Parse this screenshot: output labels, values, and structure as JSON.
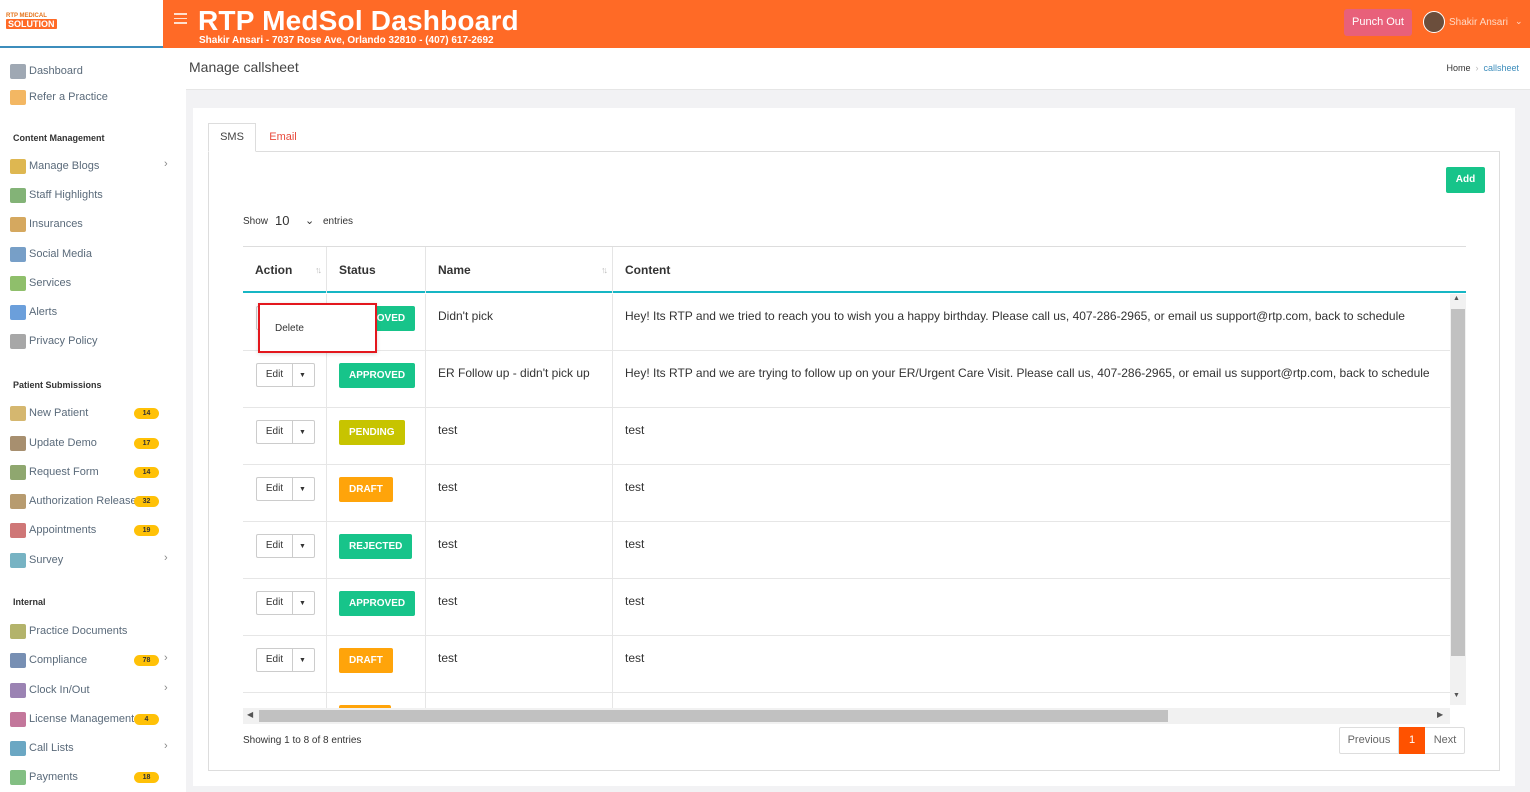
{
  "header": {
    "logo_line1": "RTP MEDICAL",
    "logo_line2": "SOLUTION",
    "title": "RTP MedSol Dashboard",
    "subtitle": "Shakir Ansari - 7037 Rose Ave, Orlando 32810 - (407) 617-2692",
    "punch_label": "Punch Out",
    "user_name": "Shakir Ansari",
    "brand_color": "#ff6a26"
  },
  "sidebar": {
    "top_items": [
      {
        "label": "Dashboard",
        "icon": "gauge-icon"
      },
      {
        "label": "Refer a Practice",
        "icon": "envelope-icon"
      }
    ],
    "sections": {
      "content": "Content Management",
      "patient": "Patient Submissions",
      "internal": "Internal"
    },
    "content_items": [
      {
        "label": "Manage Blogs",
        "icon": "blog-icon"
      },
      {
        "label": "Staff Highlights",
        "icon": "staff-icon"
      },
      {
        "label": "Insurances",
        "icon": "insurance-icon"
      },
      {
        "label": "Social Media",
        "icon": "social-media-icon"
      },
      {
        "label": "Services",
        "icon": "services-icon"
      },
      {
        "label": "Alerts",
        "icon": "alerts-icon"
      },
      {
        "label": "Privacy Policy",
        "icon": "privacy-icon"
      }
    ],
    "patient_items": [
      {
        "label": "New Patient",
        "badge": "14",
        "icon": "clipboard-icon"
      },
      {
        "label": "Update Demo",
        "badge": "17",
        "icon": "id-card-icon"
      },
      {
        "label": "Request Form",
        "badge": "14",
        "icon": "form-icon"
      },
      {
        "label": "Authorization Release",
        "badge": "32",
        "icon": "authorization-icon"
      },
      {
        "label": "Appointments",
        "badge": "19",
        "icon": "calendar-icon"
      },
      {
        "label": "Survey",
        "icon": "survey-icon"
      }
    ],
    "internal_items": [
      {
        "label": "Practice Documents",
        "icon": "documents-icon"
      },
      {
        "label": "Compliance",
        "badge": "78",
        "icon": "compliance-icon"
      },
      {
        "label": "Clock In/Out",
        "icon": "clock-icon"
      },
      {
        "label": "License Management",
        "badge": "4",
        "icon": "license-icon"
      },
      {
        "label": "Call Lists",
        "icon": "call-list-icon"
      },
      {
        "label": "Payments",
        "badge": "18",
        "icon": "payments-icon"
      }
    ]
  },
  "page": {
    "title": "Manage callsheet",
    "breadcrumb_home": "Home",
    "breadcrumb_current": "callsheet"
  },
  "tabs": {
    "sms": "SMS",
    "email": "Email"
  },
  "toolbar": {
    "add_label": "Add",
    "show_label": "Show",
    "entries_value": "10",
    "entries_label": "entries"
  },
  "table": {
    "columns": {
      "action": "Action",
      "status": "Status",
      "name": "Name",
      "content": "Content"
    },
    "edit_label": "Edit",
    "rows": [
      {
        "status": "APPROVED",
        "status_color": "#17c48a",
        "name": "Didn't pick",
        "content": "Hey! Its RTP and we tried to reach you to wish you a happy birthday. Please call us, 407-286-2965, or email us support@rtp.com, back to schedule"
      },
      {
        "status": "APPROVED",
        "status_color": "#17c48a",
        "name": "ER Follow up - didn't pick up",
        "content": "Hey! Its RTP and we are trying to follow up on your ER/Urgent Care Visit. Please call us, 407-286-2965, or email us support@rtp.com, back to schedule"
      },
      {
        "status": "PENDING",
        "status_color": "#c7c400",
        "name": "test",
        "content": "test"
      },
      {
        "status": "DRAFT",
        "status_color": "#ffa40a",
        "name": "test",
        "content": "test"
      },
      {
        "status": "REJECTED",
        "status_color": "#17c48a",
        "name": "test",
        "content": "test"
      },
      {
        "status": "APPROVED",
        "status_color": "#17c48a",
        "name": "test",
        "content": "test"
      },
      {
        "status": "DRAFT",
        "status_color": "#ffa40a",
        "name": "test",
        "content": "test"
      }
    ],
    "dropdown_delete": "Delete"
  },
  "footer": {
    "showing": "Showing 1 to 8 of 8 entries",
    "previous": "Previous",
    "page": "1",
    "next": "Next"
  }
}
